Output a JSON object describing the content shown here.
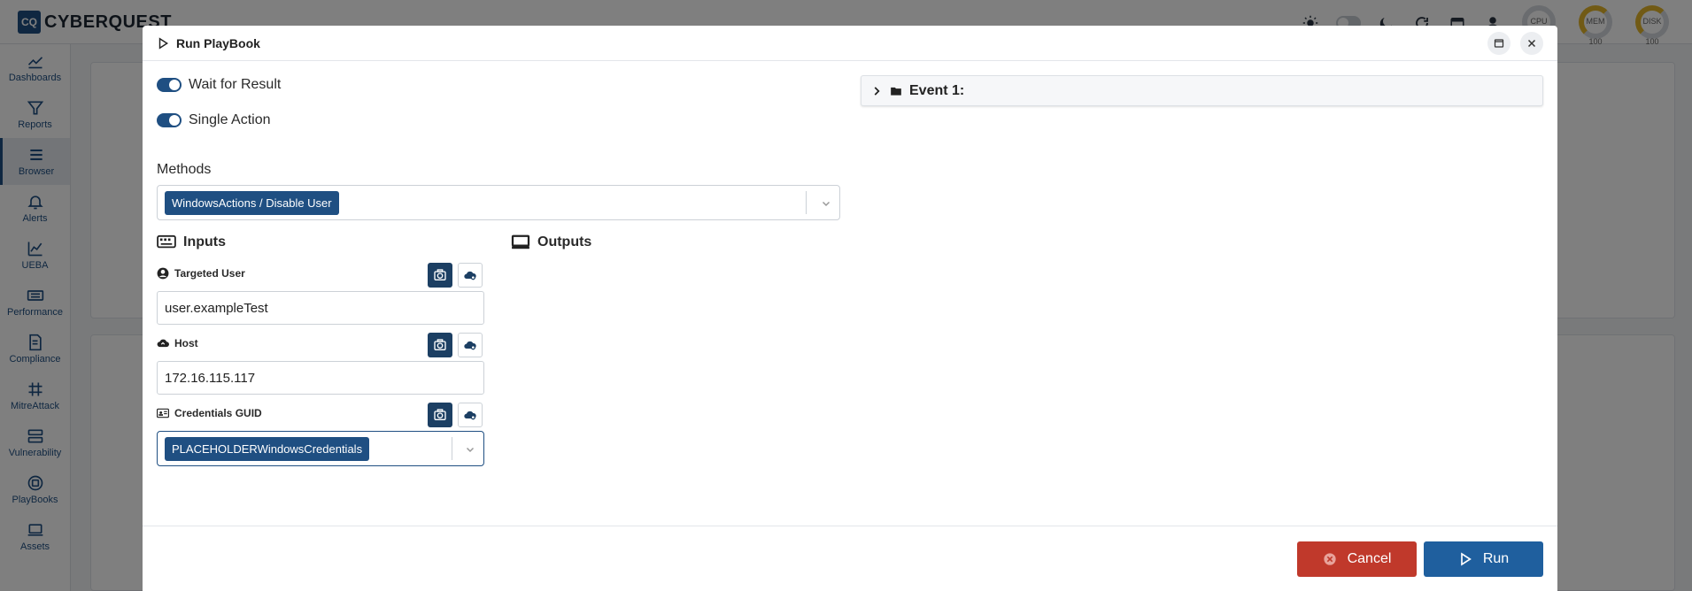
{
  "app": {
    "brand_mark": "CQ",
    "brand_name": "CYBERQUEST",
    "gauges": [
      {
        "label": "CPU",
        "value": ""
      },
      {
        "label": "MEM",
        "value": "100"
      },
      {
        "label": "DISK",
        "value": "100"
      }
    ]
  },
  "sidebar": {
    "items": [
      {
        "label": "Dashboards",
        "icon": "dashboard-icon"
      },
      {
        "label": "Reports",
        "icon": "filter-icon"
      },
      {
        "label": "Browser",
        "icon": "list-icon"
      },
      {
        "label": "Alerts",
        "icon": "bell-icon"
      },
      {
        "label": "UEBA",
        "icon": "chart-icon"
      },
      {
        "label": "Performance",
        "icon": "keyboard-icon"
      },
      {
        "label": "Compliance",
        "icon": "document-icon"
      },
      {
        "label": "MitreAttack",
        "icon": "grid-icon"
      },
      {
        "label": "Vulnerability",
        "icon": "server-icon"
      },
      {
        "label": "PlayBooks",
        "icon": "playbook-icon"
      },
      {
        "label": "Assets",
        "icon": "laptop-icon"
      }
    ]
  },
  "modal": {
    "title": "Run PlayBook",
    "wait_for_result": {
      "label": "Wait for Result",
      "on": true
    },
    "single_action": {
      "label": "Single Action",
      "on": true
    },
    "methods": {
      "label": "Methods",
      "selected": "WindowsActions / Disable User"
    },
    "inputs": {
      "title": "Inputs",
      "targeted_user": {
        "label": "Targeted User",
        "value": "user.exampleTest"
      },
      "host": {
        "label": "Host",
        "value": "172.16.115.117"
      },
      "credentials": {
        "label": "Credentials GUID",
        "selected": "PLACEHOLDERWindowsCredentials"
      }
    },
    "outputs": {
      "title": "Outputs"
    },
    "event": {
      "title": "Event 1:"
    },
    "footer": {
      "cancel_label": "Cancel",
      "run_label": "Run"
    }
  },
  "colors": {
    "primary": "#1f4f82",
    "dark_button": "#1c3f63",
    "cancel": "#c0392b",
    "run": "#1f5f9e"
  }
}
